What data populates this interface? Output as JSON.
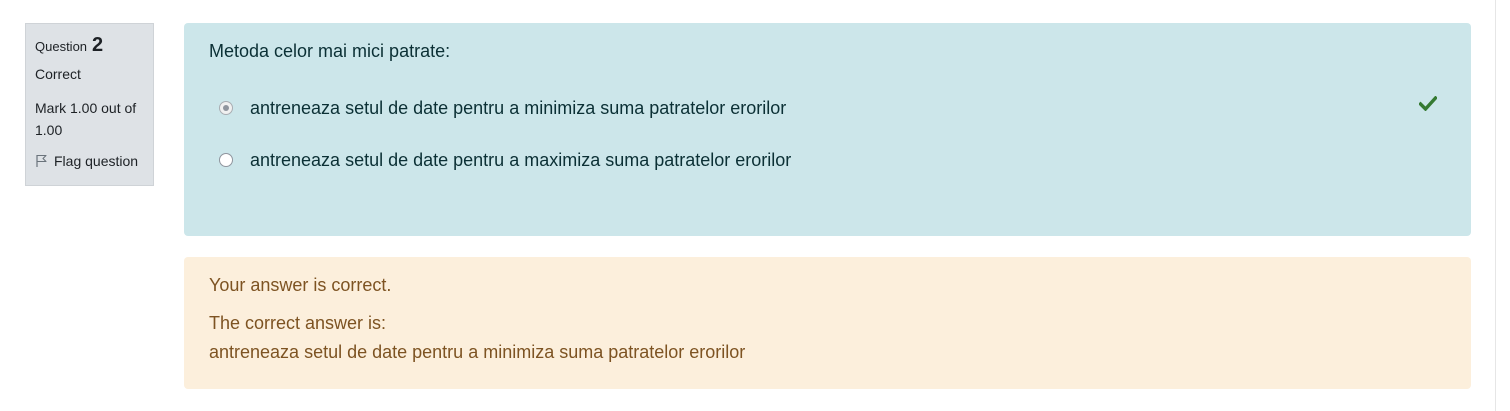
{
  "info": {
    "question_label": "Question",
    "question_number": "2",
    "state": "Correct",
    "grade": "Mark 1.00 out of 1.00",
    "flag_label": "Flag question"
  },
  "question": {
    "text": "Metoda celor mai mici patrate:",
    "answers": [
      {
        "label": "antreneaza setul de date pentru a minimiza suma patratelor erorilor",
        "selected": true,
        "correct": true
      },
      {
        "label": "antreneaza setul de date pentru a maximiza suma patratelor erorilor",
        "selected": false,
        "correct": false
      }
    ]
  },
  "outcome": {
    "feedback": "Your answer is correct.",
    "right_answer_label": "The correct answer is:",
    "right_answer_text": "antreneaza setul de date pentru a minimiza suma patratelor erorilor"
  },
  "colors": {
    "formulation_bg": "#cce6ea",
    "outcome_bg": "#fcefdc",
    "info_bg": "#dee2e6",
    "check_green": "#357a32"
  },
  "icons": {
    "flag": "flag-icon",
    "check": "checkmark-icon"
  }
}
